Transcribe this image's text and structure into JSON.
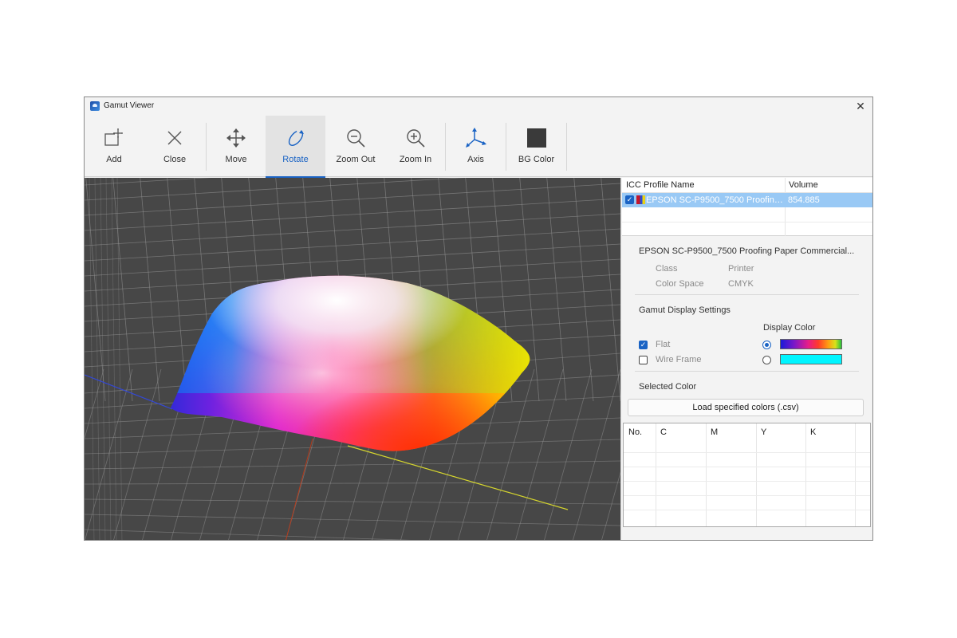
{
  "window": {
    "title": "Gamut Viewer"
  },
  "toolbar": {
    "add": "Add",
    "close": "Close",
    "move": "Move",
    "rotate": "Rotate",
    "zoom_out": "Zoom Out",
    "zoom_in": "Zoom In",
    "axis": "Axis",
    "bg_color": "BG Color",
    "active": "Rotate"
  },
  "profiles": {
    "headers": [
      "ICC Profile Name",
      "Volume"
    ],
    "rows": [
      {
        "checked": true,
        "name": "EPSON SC-P9500_7500 Proofing ...",
        "volume": "854.885",
        "selected": true
      }
    ]
  },
  "details": {
    "profile_name": "EPSON SC-P9500_7500 Proofing Paper Commercial...",
    "class_label": "Class",
    "class_value": "Printer",
    "color_space_label": "Color Space",
    "color_space_value": "CMYK"
  },
  "gamut_settings": {
    "title": "Gamut Display Settings",
    "display_color_label": "Display Color",
    "flat_label": "Flat",
    "flat_checked": true,
    "wire_label": "Wire Frame",
    "wire_checked": false,
    "flat_color_selected": true,
    "wire_color": "#00f5ff"
  },
  "selected_color": {
    "title": "Selected Color",
    "load_button": "Load specified colors (.csv)",
    "columns": [
      "No.",
      "C",
      "M",
      "Y",
      "K"
    ]
  },
  "viewport": {
    "background": "#474747",
    "grid_color": "#9a9a9a"
  }
}
